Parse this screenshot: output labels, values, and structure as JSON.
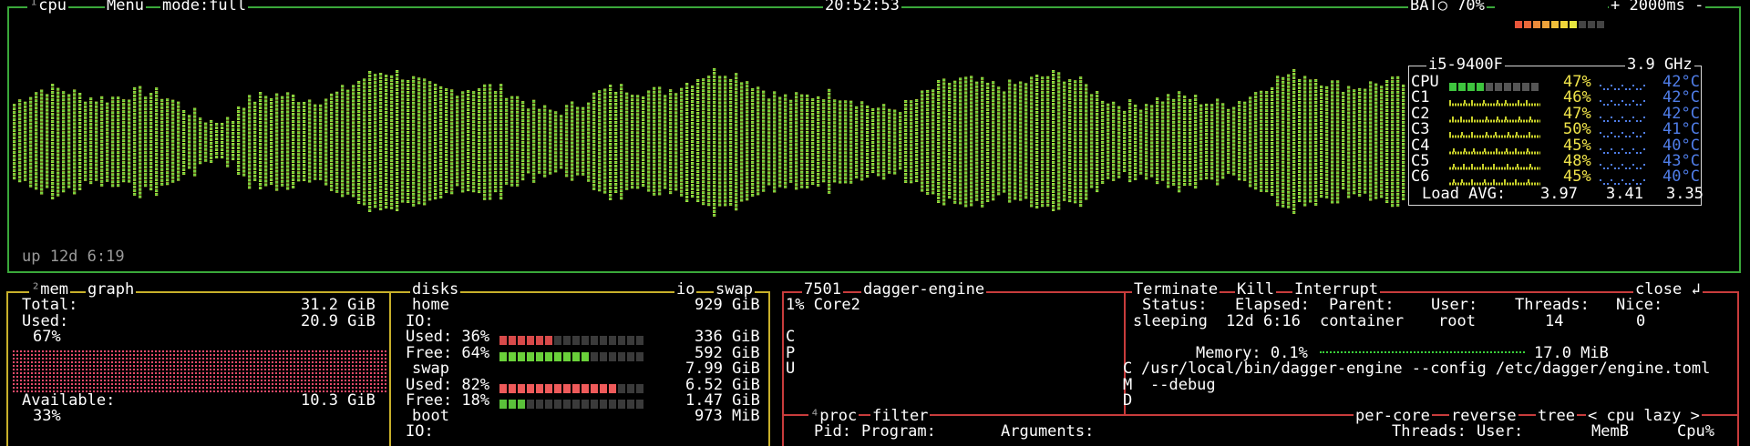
{
  "cpu": {
    "tab_index": "¹",
    "tab_label": "cpu",
    "menu_label": "Menu",
    "mode_label": "mode:full",
    "clock": "20:52:53",
    "battery_label": "BAT○ 70%",
    "battery_percent": 70,
    "rate_label": "+ 2000ms -",
    "uptime": "up 12d 6:19",
    "model": "i5-9400F",
    "freq": "3.9 GHz",
    "total_label": "CPU",
    "total_pct": "47%",
    "total_temp": "42°C",
    "cores": [
      {
        "name": "C1",
        "pct": "46%",
        "temp": "42°C"
      },
      {
        "name": "C2",
        "pct": "47%",
        "temp": "42°C"
      },
      {
        "name": "C3",
        "pct": "50%",
        "temp": "41°C"
      },
      {
        "name": "C4",
        "pct": "45%",
        "temp": "40°C"
      },
      {
        "name": "C5",
        "pct": "48%",
        "temp": "43°C"
      },
      {
        "name": "C6",
        "pct": "45%",
        "temp": "40°C"
      }
    ],
    "load_label": "Load AVG:",
    "load": [
      "3.97",
      "3.41",
      "3.35"
    ]
  },
  "mem": {
    "tab_index": "²",
    "tab_label": "mem",
    "graph_label": "graph",
    "total_label": "Total:",
    "total_value": "31.2 GiB",
    "used_label": "Used:",
    "used_value": "20.9 GiB",
    "used_pct": "67%",
    "available_label": "Available:",
    "available_value": "10.3 GiB",
    "available_pct": "33%"
  },
  "disks": {
    "tab_label": "disks",
    "io_label": "io",
    "swap_label": "swap",
    "items": [
      {
        "name": "home",
        "size": "929 GiB",
        "io": "IO:",
        "used_label": "Used: 36%",
        "used_pct": 36,
        "used_value": "336 GiB",
        "free_label": "Free: 64%",
        "free_pct": 64,
        "free_value": "592 GiB"
      },
      {
        "name": "swap",
        "size": "7.99 GiB",
        "used_label": "Used: 82%",
        "used_pct": 82,
        "used_value": "6.52 GiB",
        "free_label": "Free: 18%",
        "free_pct": 18,
        "free_value": "1.47 GiB"
      },
      {
        "name": "boot",
        "size": "973 MiB",
        "io": "IO:"
      }
    ]
  },
  "detail": {
    "pid": "7501",
    "name": "dagger-engine",
    "terminate": "Terminate",
    "kill": "Kill",
    "interrupt": "Interrupt",
    "close": "close ↲",
    "cpu_line": "1% Core2",
    "cpu_vertical": [
      "C",
      "P",
      "U"
    ],
    "status_label": "Status:",
    "status_value": "sleeping",
    "elapsed_label": "Elapsed:",
    "elapsed_value": "12d 6:16",
    "parent_label": "Parent:",
    "parent_value": "container",
    "user_label": "User:",
    "user_value": "root",
    "threads_label": "Threads:",
    "threads_value": "14",
    "nice_label": "Nice:",
    "nice_value": "0",
    "memory_label": "Memory: 0.1%",
    "memory_value": "17.0 MiB",
    "cmd_vertical": [
      "C",
      "M",
      "D"
    ],
    "cmd_line1": "/usr/local/bin/dagger-engine --config /etc/dagger/engine.toml",
    "cmd_line2": "--debug"
  },
  "proc": {
    "tab_index": "⁴",
    "tab_label": "proc",
    "filter_label": "filter",
    "per_core": "per-core",
    "reverse": "reverse",
    "tree": "tree",
    "sort": "< cpu lazy >",
    "headers": [
      "Pid:",
      "Program:",
      "Arguments:",
      "Threads:",
      "User:",
      "MemB",
      "Cpu%"
    ]
  },
  "colors": {
    "cpu_border": "#3aa83a",
    "mem_border": "#c8b02a",
    "proc_border": "#c83c3c",
    "graph_low": "#3ec43e",
    "graph_high": "#e8e840",
    "temp": "#4f7de8"
  }
}
